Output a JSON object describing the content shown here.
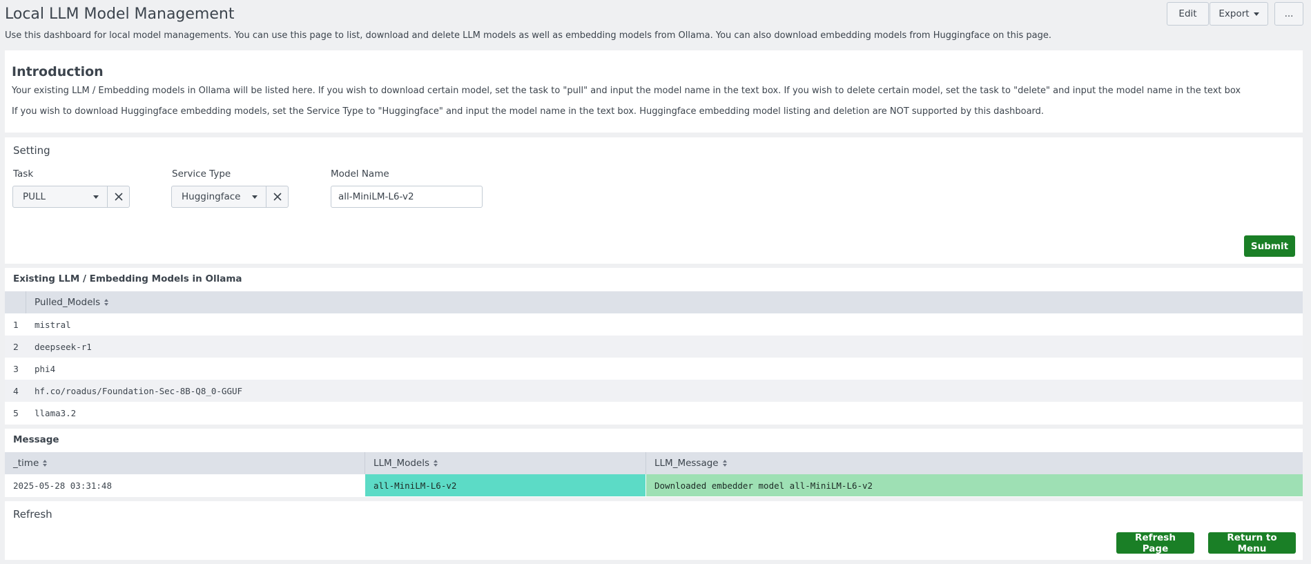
{
  "header": {
    "title": "Local LLM Model Management",
    "description": "Use this dashboard for local model managements. You can use this page to list, download and delete LLM models as well as embedding models from Ollama. You can also download embedding models from Huggingface on this page.",
    "edit_label": "Edit",
    "export_label": "Export",
    "more_label": "..."
  },
  "intro": {
    "heading": "Introduction",
    "para1": "Your existing LLM / Embedding models in Ollama will be listed here. If you wish to download certain model, set the task to \"pull\" and input the model name in the text box. If you wish to delete certain model, set the task to \"delete\" and input the model name in the text box",
    "para2": "If you wish to download Huggingface embedding models, set the Service Type to \"Huggingface\" and input the model name in the text box. Huggingface embedding model listing and deletion are NOT supported by this dashboard."
  },
  "setting": {
    "title": "Setting",
    "task_label": "Task",
    "task_value": "PULL",
    "service_label": "Service Type",
    "service_value": "Huggingface",
    "model_label": "Model Name",
    "model_value": "all-MiniLM-L6-v2",
    "submit_label": "Submit"
  },
  "models_table": {
    "title": "Existing LLM / Embedding Models in Ollama",
    "column": "Pulled_Models",
    "rows": [
      {
        "index": "1",
        "model": "mistral"
      },
      {
        "index": "2",
        "model": "deepseek-r1"
      },
      {
        "index": "3",
        "model": "phi4"
      },
      {
        "index": "4",
        "model": "hf.co/roadus/Foundation-Sec-8B-Q8_0-GGUF"
      },
      {
        "index": "5",
        "model": "llama3.2"
      }
    ]
  },
  "message_table": {
    "title": "Message",
    "columns": [
      "_time",
      "LLM_Models",
      "LLM_Message"
    ],
    "row": {
      "time": "2025-05-28 03:31:48",
      "model": "all-MiniLM-L6-v2",
      "message": "Downloaded embedder model all-MiniLM-L6-v2"
    },
    "colors": {
      "model_cell": "#5cdbc6",
      "message_cell": "#9ee0b4"
    }
  },
  "refresh": {
    "title": "Refresh",
    "refresh_label": "Refresh Page",
    "return_label": "Return to Menu"
  },
  "colors": {
    "accent_green": "#1a7f26",
    "page_bg": "#eff0f2"
  }
}
